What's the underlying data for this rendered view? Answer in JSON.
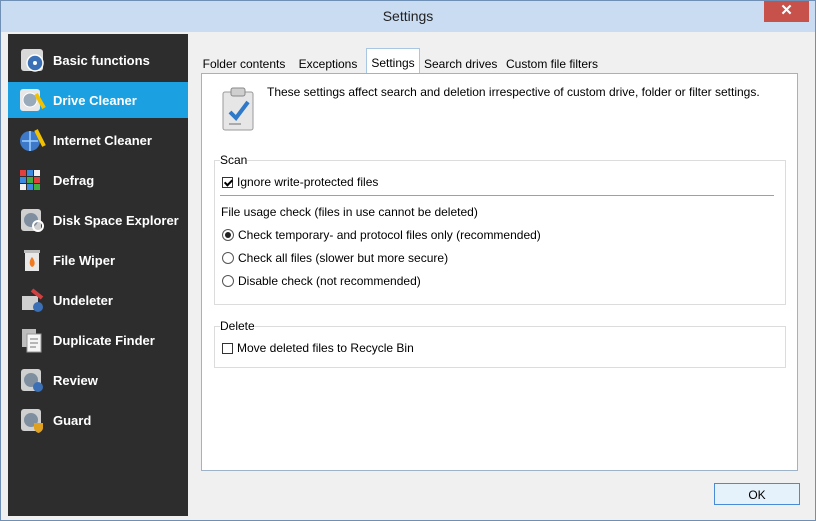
{
  "window": {
    "title": "Settings",
    "close_glyph": "✕"
  },
  "sidebar": {
    "items": [
      {
        "label": "Basic functions",
        "icon": "basic-functions-icon",
        "active": false
      },
      {
        "label": "Drive Cleaner",
        "icon": "drive-cleaner-icon",
        "active": true
      },
      {
        "label": "Internet Cleaner",
        "icon": "internet-cleaner-icon",
        "active": false
      },
      {
        "label": "Defrag",
        "icon": "defrag-icon",
        "active": false
      },
      {
        "label": "Disk Space Explorer",
        "icon": "disk-space-explorer-icon",
        "active": false
      },
      {
        "label": "File Wiper",
        "icon": "file-wiper-icon",
        "active": false
      },
      {
        "label": "Undeleter",
        "icon": "undeleter-icon",
        "active": false
      },
      {
        "label": "Duplicate Finder",
        "icon": "duplicate-finder-icon",
        "active": false
      },
      {
        "label": "Review",
        "icon": "review-icon",
        "active": false
      },
      {
        "label": "Guard",
        "icon": "guard-icon",
        "active": false
      }
    ]
  },
  "tabs": [
    {
      "label": "Folder contents",
      "active": false
    },
    {
      "label": "Exceptions",
      "active": false
    },
    {
      "label": "Settings",
      "active": true
    },
    {
      "label": "Search drives",
      "active": false
    },
    {
      "label": "Custom file filters",
      "active": false
    }
  ],
  "panel": {
    "info_text": "These settings affect search and deletion irrespective of custom drive, folder or filter settings.",
    "scan": {
      "label": "Scan",
      "ignore_write_protected": {
        "label": "Ignore write-protected files",
        "checked": true
      },
      "usage_check_label": "File usage check (files in use cannot be deleted)",
      "radios": [
        {
          "label": "Check temporary- and protocol files only (recommended)",
          "checked": true
        },
        {
          "label": "Check all files (slower but more secure)",
          "checked": false
        },
        {
          "label": "Disable check (not recommended)",
          "checked": false
        }
      ]
    },
    "delete": {
      "label": "Delete",
      "move_to_recycle_bin": {
        "label": "Move deleted files to Recycle Bin",
        "checked": false
      }
    }
  },
  "footer": {
    "ok_label": "OK"
  },
  "colors": {
    "accent": "#1ba1e2",
    "sidebar_bg": "#2d2d2d",
    "close_button": "#c7514b"
  }
}
